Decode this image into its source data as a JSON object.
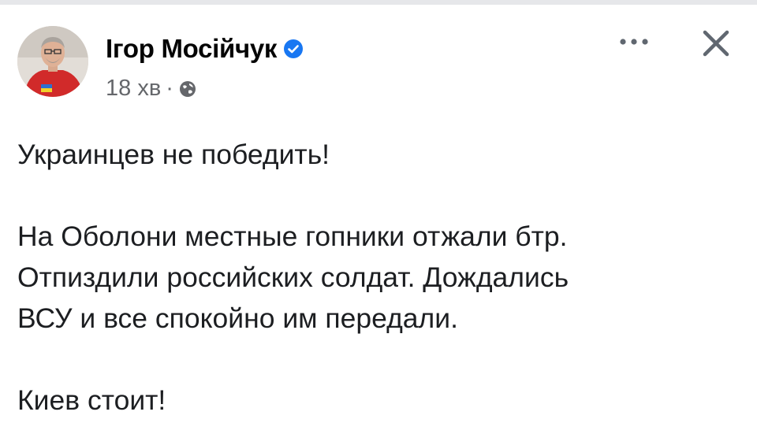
{
  "post": {
    "author": "Ігор Мосійчук",
    "time": "18 хв",
    "separator": "·",
    "verified_icon": "verified-badge-icon",
    "audience_icon": "globe-icon",
    "lines": [
      "Украинцев не победить!",
      "",
      "На Оболони местные гопники отжали бтр.",
      "Отпиздили российских солдат. Дождались",
      "ВСУ и все спокойно им передали.",
      "",
      "Киев стоит!"
    ]
  },
  "controls": {
    "more_icon": "more-horizontal-icon",
    "close_icon": "close-icon"
  },
  "colors": {
    "verified": "#1877f2",
    "meta_text": "#65676b",
    "text": "#1c1e21",
    "avatar_shirt": "#d12a2a"
  }
}
